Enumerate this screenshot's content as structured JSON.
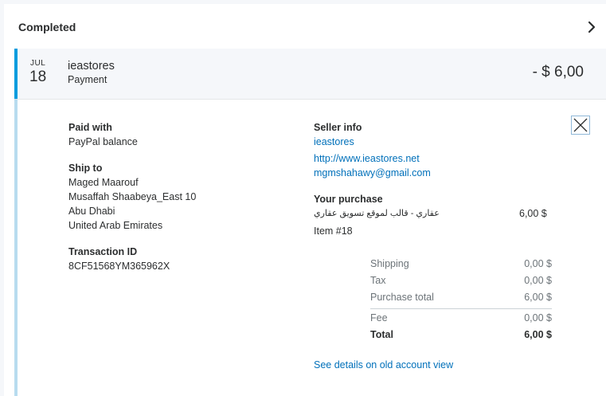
{
  "section": {
    "title": "Completed"
  },
  "transaction": {
    "month": "JUL",
    "day": "18",
    "merchant": "ieastores",
    "type": "Payment",
    "amount": "- $ 6,00"
  },
  "details": {
    "paid_with": {
      "label": "Paid with",
      "value": "PayPal balance"
    },
    "ship_to": {
      "label": "Ship to",
      "lines": [
        "Maged Maarouf",
        "Musaffah Shaabeya_East 10",
        "Abu Dhabi",
        "United Arab Emirates"
      ]
    },
    "transaction_id": {
      "label": "Transaction ID",
      "value": "8CF51568YM365962X"
    },
    "seller_info": {
      "label": "Seller info",
      "name": "ieastores",
      "website": "http://www.ieastores.net",
      "email": "mgmshahawy@gmail.com"
    },
    "purchase": {
      "label": "Your purchase",
      "item_name": "عقاري - قالب لموقع تسويق عقاري",
      "item_price": "6,00 $",
      "item_number": "Item #18"
    },
    "summary": [
      {
        "label": "Shipping",
        "value": "0,00 $"
      },
      {
        "label": "Tax",
        "value": "0,00 $"
      },
      {
        "label": "Purchase total",
        "value": "6,00 $"
      },
      {
        "label": "Fee",
        "value": "0,00 $"
      },
      {
        "label": "Total",
        "value": "6,00 $"
      }
    ],
    "old_view_link": "See details on old account view"
  },
  "colors": {
    "accent_blue": "#009cde",
    "link_blue": "#0070ba",
    "expanded_border": "#b8dcef"
  },
  "icons": {
    "chevron": "chevron-right-icon",
    "close": "close-icon"
  }
}
